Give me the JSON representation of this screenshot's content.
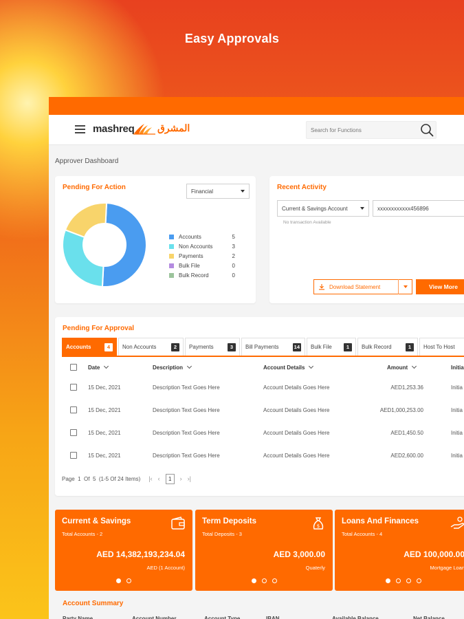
{
  "banner": {
    "title": "Easy Approvals"
  },
  "header": {
    "logo_en": "mashreq",
    "logo_ar": "المشرق",
    "search_placeholder": "Search for Functions"
  },
  "page": {
    "title": "Approver Dashboard"
  },
  "pending_for_action": {
    "title": "Pending For Action",
    "filter_value": "Financial",
    "legend": [
      {
        "label": "Accounts",
        "value": "5",
        "color": "#4a9cf0"
      },
      {
        "label": "Non Accounts",
        "value": "3",
        "color": "#6ae0ec"
      },
      {
        "label": "Payments",
        "value": "2",
        "color": "#f8d46b"
      },
      {
        "label": "Bulk File",
        "value": "0",
        "color": "#b48be0"
      },
      {
        "label": "Bulk Record",
        "value": "0",
        "color": "#9cc49c"
      }
    ]
  },
  "recent_activity": {
    "title": "Recent Activity",
    "account_type": "Current & Savings Account",
    "account_number": "xxxxxxxxxxxx456896",
    "empty_message": "No transaction Available",
    "download_label": "Download Statement",
    "view_more_label": "View More"
  },
  "pending_for_approval": {
    "title": "Pending For Approval",
    "tabs": [
      {
        "label": "Accounts",
        "count": "4"
      },
      {
        "label": "Non Accounts",
        "count": "2"
      },
      {
        "label": "Payments",
        "count": "3"
      },
      {
        "label": "Bill Payments",
        "count": "14"
      },
      {
        "label": "Bulk File",
        "count": "1"
      },
      {
        "label": "Bulk Record",
        "count": "1"
      },
      {
        "label": "Host To Host",
        "count": ""
      }
    ],
    "columns": {
      "date": "Date",
      "description": "Description",
      "account": "Account Details",
      "amount": "Amount",
      "initiated": "Initia"
    },
    "rows": [
      {
        "date": "15 Dec, 2021",
        "description": "Description Text Goes Here",
        "account": "Account Details Goes Here",
        "amount": "AED1,253.36",
        "initiated": "Initia"
      },
      {
        "date": "15 Dec, 2021",
        "description": "Description Text Goes Here",
        "account": "Account Details Goes Here",
        "amount": "AED1,000,253.00",
        "initiated": "Initia"
      },
      {
        "date": "15 Dec, 2021",
        "description": "Description Text Goes Here",
        "account": "Account Details Goes Here",
        "amount": "AED1,450.50",
        "initiated": "Initia"
      },
      {
        "date": "15 Dec, 2021",
        "description": "Description Text Goes Here",
        "account": "Account Details Goes Here",
        "amount": "AED2,600.00",
        "initiated": "Initia"
      }
    ],
    "pager": {
      "page_label": "Page",
      "page": "1",
      "of_label": "Of",
      "total_pages": "5",
      "range": "(1-5 Of 24 Items)",
      "current": "1"
    }
  },
  "account_cards": [
    {
      "title": "Current & Savings",
      "subtitle": "Total Accounts - 2",
      "amount": "AED 14,382,193,234.04",
      "note": "AED (1 Account)",
      "icon": "wallet-icon",
      "dots": 2
    },
    {
      "title": "Term Deposits",
      "subtitle": "Total Deposits - 3",
      "amount": "AED 3,000.00",
      "note": "Quaterly",
      "icon": "money-bag-icon",
      "dots": 3
    },
    {
      "title": "Loans And Finances",
      "subtitle": "Total Accounts - 4",
      "amount": "AED 100,000.00",
      "note": "Mortgage Loan",
      "icon": "hand-coins-icon",
      "dots": 4
    }
  ],
  "account_summary": {
    "title": "Account Summary",
    "columns": [
      "Party Name",
      "Account Number",
      "Account Type",
      "IBAN",
      "Available Balance",
      "Net Balance"
    ]
  },
  "colors": {
    "accent": "#ff6a00",
    "dark": "#333333"
  }
}
